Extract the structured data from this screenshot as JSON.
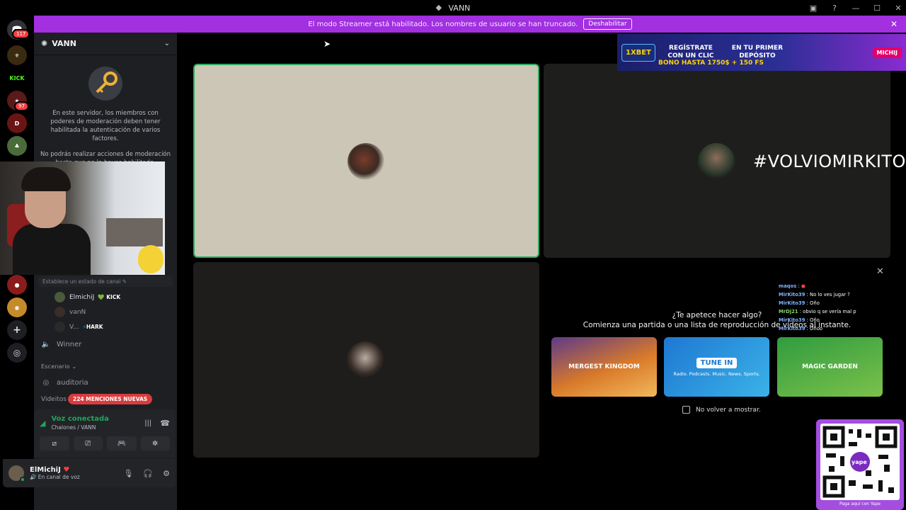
{
  "window": {
    "title": "VANN"
  },
  "streamer_bar": {
    "message": "El modo Streamer está habilitado. Los nombres de usuario se han truncado.",
    "disable_label": "Deshabilitar"
  },
  "guild_rail": {
    "dm_badge": "117",
    "guild_badge": "97",
    "guild_labels": [
      "KICK"
    ]
  },
  "sidebar": {
    "server_name": "VANN",
    "notice_p1": "En este servidor, los miembros con poderes de moderación deben tener habilitada la autenticación de varios factores.",
    "notice_p2": "No podrás realizar acciones de moderación hasta que no la hayas habilitado.",
    "channel_status": "Establece un estado de canal",
    "voice_users": [
      {
        "name": "ElmichiJ",
        "tag": "KICK"
      },
      {
        "name": "vanN",
        "tag": ""
      },
      {
        "name": "V...",
        "tag": "HARK"
      }
    ],
    "channels": {
      "winner": "Winner",
      "category_stage": "Escenario",
      "auditoria": "auditoria",
      "videitos": "Videitos"
    },
    "mentions_badge": "224 MENCIONES NUEVAS"
  },
  "voice_panel": {
    "title": "Voz conectada",
    "subtitle": "Chalones / VANN"
  },
  "user_panel": {
    "username": "ElMichiJ",
    "status": "En canal de voz"
  },
  "tiles": {
    "hashtag": "#VOLVIOMIRKITO"
  },
  "activity": {
    "title": "¿Te apetece hacer algo?",
    "subtitle": "Comienza una partida o una lista de reproducción de vídeos al instante.",
    "games": [
      {
        "name": "MERGEST KINGDOM"
      },
      {
        "name": "TUNE IN",
        "tagline": "Radio. Podcasts. Music. News. Sports."
      },
      {
        "name": "MAGIC GARDEN"
      }
    ],
    "dont_show": "No volver a mostrar."
  },
  "ad_banner": {
    "logo": "1XBET",
    "text1": "REGÍSTRATE CON UN CLIC",
    "text2": "EN TU PRIMER DEPÓSITO",
    "text3": "BONO HASTA 1750$ + 150 FS",
    "brand": "MICHIJ"
  },
  "chat": [
    {
      "user": "maqos",
      "msg": ""
    },
    {
      "user": "MirKito39",
      "msg": "No lo ves jugar ?"
    },
    {
      "user": "MirKito39",
      "msg": "Oño"
    },
    {
      "user": "MrDj21",
      "msg": "obvio q se vería mal p"
    },
    {
      "user": "MirKito39",
      "msg": "Oño"
    },
    {
      "user": "MirKito39",
      "msg": "Oñoo"
    }
  ],
  "qr": {
    "brand": "yape",
    "caption": "Paga aquí con Yape"
  }
}
